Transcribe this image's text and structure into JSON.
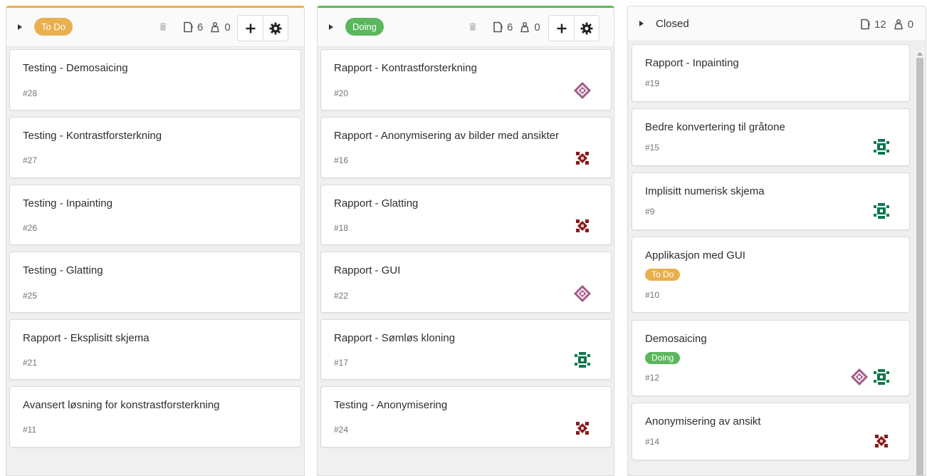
{
  "columns": {
    "todo": {
      "label": "To Do",
      "label_color": "#e9b04e",
      "issue_count": "6",
      "weight_count": "0",
      "cards": [
        {
          "title": "Testing - Demosaicing",
          "number": "#28"
        },
        {
          "title": "Testing - Kontrastforsterkning",
          "number": "#27"
        },
        {
          "title": "Testing - Inpainting",
          "number": "#26"
        },
        {
          "title": "Testing - Glatting",
          "number": "#25"
        },
        {
          "title": "Rapport - Eksplisitt skjema",
          "number": "#21"
        },
        {
          "title": "Avansert løsning for konstrastforsterkning",
          "number": "#11"
        }
      ]
    },
    "doing": {
      "label": "Doing",
      "label_color": "#5bb75b",
      "issue_count": "6",
      "weight_count": "0",
      "cards": [
        {
          "title": "Rapport - Kontrastforsterkning",
          "number": "#20",
          "assignee": "purple-avatar"
        },
        {
          "title": "Rapport - Anonymisering av bilder med ansikter",
          "number": "#16",
          "assignee": "red-avatar"
        },
        {
          "title": "Rapport - Glatting",
          "number": "#18",
          "assignee": "red-avatar"
        },
        {
          "title": "Rapport - GUI",
          "number": "#22",
          "assignee": "purple-avatar"
        },
        {
          "title": "Rapport - Sømløs kloning",
          "number": "#17",
          "assignee": "green-avatar"
        },
        {
          "title": "Testing - Anonymisering",
          "number": "#24",
          "assignee": "red-avatar"
        }
      ]
    },
    "closed": {
      "title": "Closed",
      "issue_count": "12",
      "weight_count": "0",
      "cards": [
        {
          "title": "Rapport - Inpainting",
          "number": "#19"
        },
        {
          "title": "Bedre konvertering til gråtone",
          "number": "#15",
          "assignee": "green-avatar"
        },
        {
          "title": "Implisitt numerisk skjema",
          "number": "#9",
          "assignee": "green-avatar"
        },
        {
          "title": "Applikasjon med GUI",
          "number": "#10",
          "tag": "To Do"
        },
        {
          "title": "Demosaicing",
          "number": "#12",
          "tag": "Doing",
          "assignees": [
            "purple-avatar",
            "green-avatar"
          ]
        },
        {
          "title": "Anonymisering av ansikt",
          "number": "#14",
          "assignee": "red-avatar"
        }
      ]
    }
  },
  "colors": {
    "todo": "#e9b04e",
    "doing": "#5bb75b",
    "avatar_purple": "#a05a86",
    "avatar_red": "#8b1a1a",
    "avatar_green": "#0f7a4f"
  }
}
